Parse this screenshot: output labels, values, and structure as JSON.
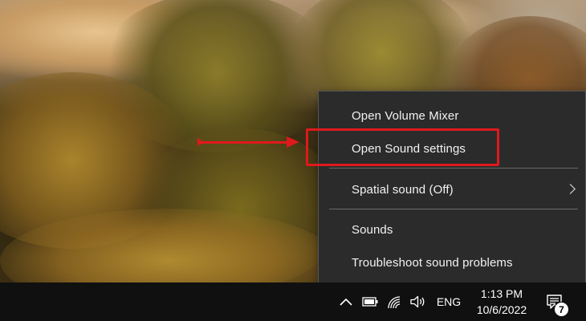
{
  "context_menu": {
    "items": [
      {
        "label": "Open Volume Mixer"
      },
      {
        "label": "Open Sound settings"
      },
      {
        "label": "Spatial sound (Off)",
        "has_submenu": true
      },
      {
        "label": "Sounds"
      },
      {
        "label": "Troubleshoot sound problems"
      }
    ]
  },
  "annotation": {
    "color": "#e0191c",
    "target": "Open Sound settings"
  },
  "taskbar": {
    "tray_icons": [
      "chevron-up-icon",
      "battery-icon",
      "wifi-icon",
      "speaker-icon"
    ],
    "language": "ENG",
    "time": "1:13 PM",
    "date": "10/6/2022",
    "notification_count": "7"
  }
}
